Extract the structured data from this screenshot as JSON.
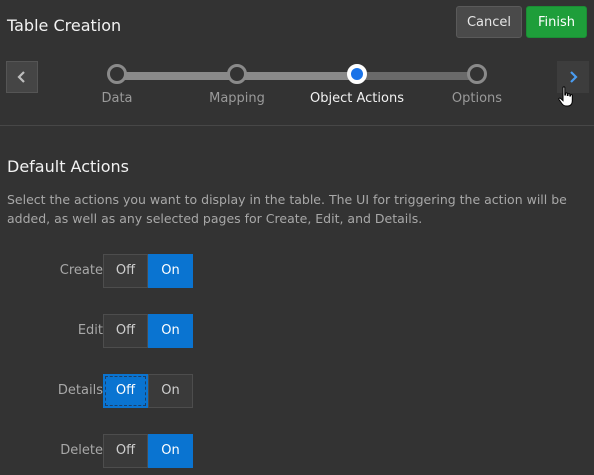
{
  "header": {
    "title": "Table Creation",
    "cancel_label": "Cancel",
    "finish_label": "Finish"
  },
  "stepper": {
    "steps": [
      {
        "label": "Data",
        "state": "done"
      },
      {
        "label": "Mapping",
        "state": "done"
      },
      {
        "label": "Object Actions",
        "state": "active"
      },
      {
        "label": "Options",
        "state": "todo"
      }
    ],
    "prev_icon": "chevron-left-icon",
    "next_icon": "chevron-right-icon"
  },
  "section": {
    "title": "Default Actions",
    "description": "Select the actions you want to display in the table. The UI for triggering the action will be added, as well as any selected pages for Create, Edit, and Details."
  },
  "actions": [
    {
      "label": "Create",
      "off_label": "Off",
      "on_label": "On",
      "value": "On"
    },
    {
      "label": "Edit",
      "off_label": "Off",
      "on_label": "On",
      "value": "On"
    },
    {
      "label": "Details",
      "off_label": "Off",
      "on_label": "On",
      "value": "Off"
    },
    {
      "label": "Delete",
      "off_label": "Off",
      "on_label": "On",
      "value": "On"
    }
  ],
  "colors": {
    "background": "#333333",
    "accent": "#0a74d1",
    "finish": "#1e9e3a"
  }
}
